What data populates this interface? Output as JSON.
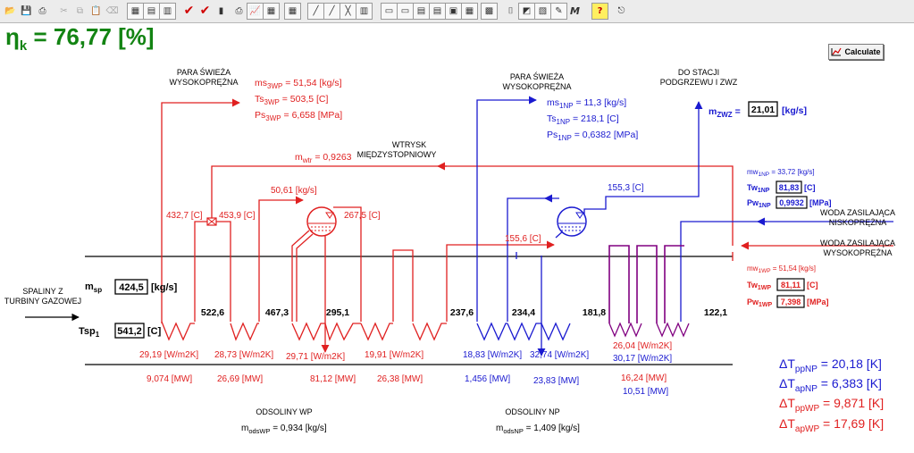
{
  "toolbar": {
    "icons": [
      "open-folder-icon",
      "save-icon",
      "print-icon",
      "cut-icon",
      "copy-icon",
      "paste-icon",
      "delete-icon",
      "calculator-icon",
      "table-icon",
      "table-alt-icon",
      "check-icon",
      "check-alt-icon",
      "instrument-icon",
      "printer-icon",
      "graph-icon",
      "graph-alt-icon",
      "grid-icon",
      "chart-1-icon",
      "chart-2-icon",
      "chart-3-icon",
      "chart-4-icon",
      "panel-1-icon",
      "panel-2-icon",
      "panel-3-icon",
      "panel-4-icon",
      "panel-5-icon",
      "panel-6-icon",
      "book-icon",
      "photo-chart-icon",
      "photo-chart-alt-icon",
      "image-icon",
      "edit-icon",
      "macro-icon",
      "help-icon",
      "exit-icon"
    ],
    "macro_label": "M",
    "help_label": "?"
  },
  "efficiency": {
    "symbol": "η",
    "sub": "k",
    "value": " = 76,77 [%]"
  },
  "calculate_label": "Calculate",
  "labels": {
    "para_wp_1": "PARA ŚWIEŻA",
    "para_wp_2": "WYSOKOPRĘŻNA",
    "para_np_1": "PARA ŚWIEŻA",
    "para_np_2": "WYSOKOPRĘŻNA",
    "do_stacji_1": "DO STACJI",
    "do_stacji_2": "PODGRZEWU I ZWZ",
    "wtrysk_1": "WTRYSK",
    "wtrysk_2": "MIĘDZYSTOPNIOWY",
    "woda_np_1": "WODA ZASILAJĄCA",
    "woda_np_2": "NISKOPRĘŻNA",
    "woda_wp_1": "WODA ZASILAJĄCA",
    "woda_wp_2": "WYSOKOPRĘŻNA",
    "spaliny_1": "SPALINY Z",
    "spaliny_2": "TURBINY GAZOWEJ",
    "odsoliny_wp": "ODSOLINY WP",
    "odsoliny_np": "ODSOLINY NP"
  },
  "steam_wp": {
    "ms": {
      "main": "ms",
      "sub": "3WP",
      "rest": " = 51,54 [kg/s]"
    },
    "ts": {
      "main": "Ts",
      "sub": "3WP",
      "rest": " = 503,5 [C]"
    },
    "ps": {
      "main": "Ps",
      "sub": "3WP",
      "rest": " = 6,658 [MPa]"
    }
  },
  "steam_np": {
    "ms": {
      "main": "ms",
      "sub": "1NP",
      "rest": " = 11,3 [kg/s]"
    },
    "ts": {
      "main": "Ts",
      "sub": "1NP",
      "rest": " = 218,1 [C]"
    },
    "ps": {
      "main": "Ps",
      "sub": "1NP",
      "rest": " = 0,6382 [MPa]"
    }
  },
  "zwz": {
    "main": "m",
    "sub": "ZWZ",
    "rest": " =",
    "value": "21,01",
    "unit": "[kg/s]"
  },
  "wtrysk": {
    "main": "m",
    "sub": "wtr",
    "rest": " = 0,9263"
  },
  "feed_np": {
    "mw": {
      "main": "mw",
      "sub": "1NP",
      "rest": " = 33,72 [kg/s]"
    },
    "tw": {
      "main": "Tw",
      "sub": "1NP",
      "value": "81,83",
      "unit": "[C]"
    },
    "pw": {
      "main": "Pw",
      "sub": "1NP",
      "value": "0,9932",
      "unit": "[MPa]"
    }
  },
  "feed_wp": {
    "mw": {
      "main": "mw",
      "sub": "1WP",
      "rest": " = 51,54 [kg/s]"
    },
    "tw": {
      "main": "Tw",
      "sub": "1WP",
      "value": "81,11",
      "unit": "[C]"
    },
    "pw": {
      "main": "Pw",
      "sub": "1WP",
      "value": "7,398",
      "unit": "[MPa]"
    }
  },
  "gas": {
    "msp": {
      "main": "m",
      "sub": "sp",
      "value": "424,5",
      "unit": "[kg/s]"
    },
    "tsp": {
      "main": "Tsp",
      "sub": "1",
      "value": "541,2",
      "unit": "[C]"
    }
  },
  "gas_temps": [
    "522,6",
    "467,3",
    "295,1",
    "237,6",
    "234,4",
    "181,8",
    "122,1"
  ],
  "water_temps": {
    "t1": "432,7 [C]",
    "t2": "453,9 [C]",
    "flow": "50,61 [kg/s]",
    "t3": "267,5 [C]",
    "t4": "155,6 [C]",
    "t5": "155,3 [C]"
  },
  "coefficients": {
    "k1": "29,19 [W/m2K]",
    "k2": "28,73 [W/m2K]",
    "k3": "29,71 [W/m2K]",
    "k4": "19,91 [W/m2K]",
    "k5": "18,83 [W/m2K]",
    "k6": "32,74 [W/m2K]",
    "k7": "26,04 [W/m2K]",
    "k8": "30,17 [W/m2K]"
  },
  "powers": {
    "p1": "9,074 [MW]",
    "p2": "26,69 [MW]",
    "p3": "81,12 [MW]",
    "p4": "26,38 [MW]",
    "p5": "1,456 [MW]",
    "p6": "23,83 [MW]",
    "p7": "16,24 [MW]",
    "p8": "10,51 [MW]"
  },
  "blowdown_wp": {
    "main": "m",
    "sub": "odsWP",
    "rest": " = 0,934 [kg/s]"
  },
  "blowdown_np": {
    "main": "m",
    "sub": "odsNP",
    "rest": " = 1,409 [kg/s]"
  },
  "deltas": [
    {
      "main": "ΔT",
      "sub": "ppNP",
      "rest": " = 20,18 [K]",
      "color": "#1a1ad0"
    },
    {
      "main": "ΔT",
      "sub": "apNP",
      "rest": " = 6,383 [K]",
      "color": "#1a1ad0"
    },
    {
      "main": "ΔT",
      "sub": "ppWP",
      "rest": " = 9,871 [K]",
      "color": "#e02020"
    },
    {
      "main": "ΔT",
      "sub": "apWP",
      "rest": " = 17,69 [K]",
      "color": "#e02020"
    }
  ],
  "colors": {
    "hp": "#e02020",
    "lp": "#1a1ad0",
    "mixed": "#800080",
    "efficiency": "#138413"
  }
}
